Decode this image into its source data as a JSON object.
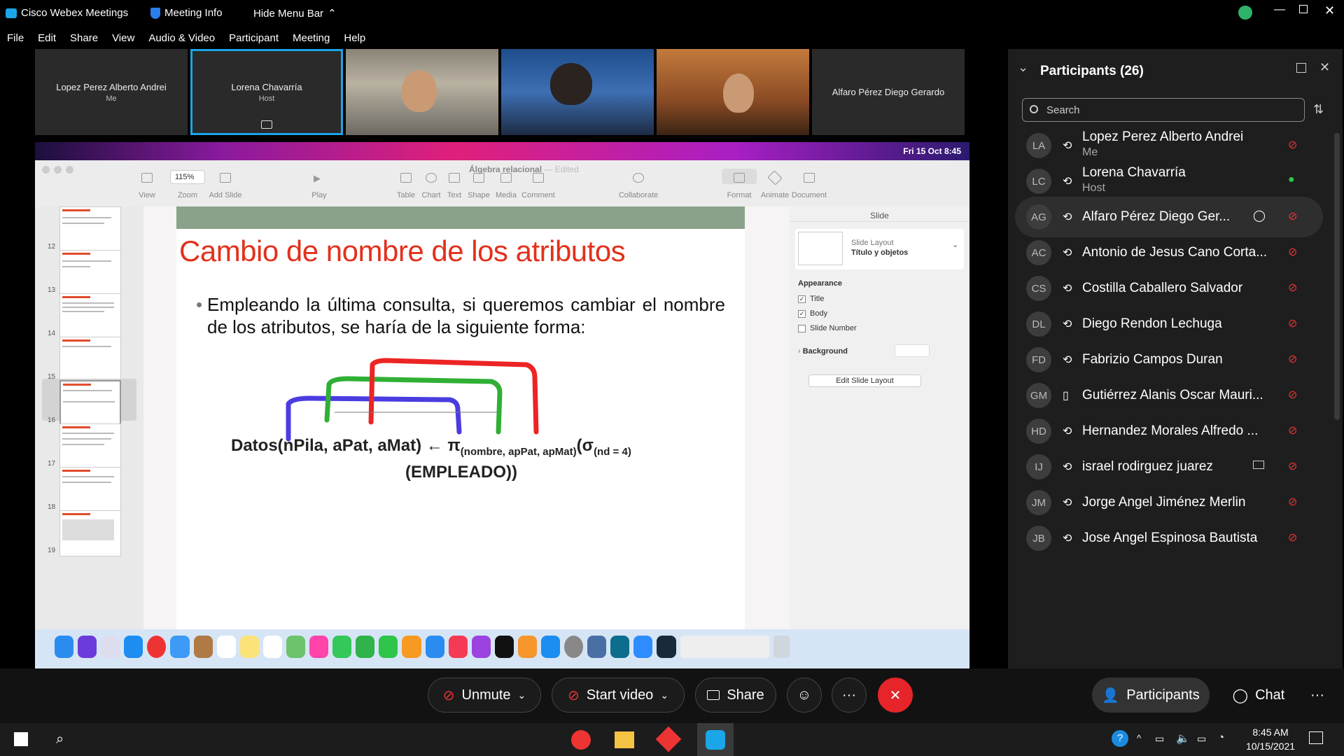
{
  "titlebar": {
    "app": "Cisco Webex Meetings",
    "meeting_info": "Meeting Info",
    "hide_menu": "Hide Menu Bar"
  },
  "menu": [
    "File",
    "Edit",
    "Share",
    "View",
    "Audio & Video",
    "Participant",
    "Meeting",
    "Help"
  ],
  "strip": [
    {
      "name": "Lopez Perez Alberto Andrei",
      "sub": "Me"
    },
    {
      "name": "Lorena Chavarría",
      "sub": "Host"
    },
    {
      "name": "Alfaro Pérez Diego Gerardo",
      "sub": ""
    }
  ],
  "share": {
    "mac_clock": "Fri 15 Oct  8:45",
    "doc_title": "Álgebra relacional",
    "doc_state": "— Edited",
    "toolbar": {
      "view": "View",
      "zoom_value": "115%",
      "zoom": "Zoom",
      "add_slide": "Add Slide",
      "play": "Play",
      "table": "Table",
      "chart": "Chart",
      "text": "Text",
      "shape": "Shape",
      "media": "Media",
      "comment": "Comment",
      "collaborate": "Collaborate",
      "format": "Format",
      "animate": "Animate",
      "document": "Document"
    },
    "slide_numbers": [
      "12",
      "13",
      "14",
      "15",
      "16",
      "17",
      "18",
      "19"
    ],
    "slide": {
      "title": "Cambio de nombre de los atributos",
      "bullet": "Empleando la última consulta, si queremos cambiar el nombre de los atributos, se haría de la siguiente forma:",
      "formula_main": "Datos(nPila, aPat, aMat) ← π",
      "formula_sub1": "(nombre, apPat, apMat)",
      "formula_sigma": "(σ",
      "formula_sub2": "(nd = 4)",
      "formula_line2": "(EMPLEADO))"
    },
    "inspector": {
      "tab": "Slide",
      "layout_label": "Slide Layout",
      "layout_value": "Título y objetos",
      "appearance": "Appearance",
      "title_cb": "Title",
      "body_cb": "Body",
      "slidenum_cb": "Slide Number",
      "background": "Background",
      "edit_layout": "Edit Slide Layout"
    }
  },
  "controls": {
    "unmute": "Unmute",
    "start_video": "Start video",
    "share": "Share",
    "participants": "Participants",
    "chat": "Chat"
  },
  "panel": {
    "title": "Participants (26)",
    "search_placeholder": "Search",
    "participants": [
      {
        "initials": "LA",
        "name": "Lopez Perez Alberto Andrei",
        "sub": "Me"
      },
      {
        "initials": "LC",
        "name": "Lorena Chavarría",
        "sub": "Host"
      },
      {
        "initials": "AG",
        "name": "Alfaro Pérez Diego Ger...",
        "sub": ""
      },
      {
        "initials": "AC",
        "name": "Antonio de Jesus Cano Corta...",
        "sub": ""
      },
      {
        "initials": "CS",
        "name": "Costilla Caballero Salvador",
        "sub": ""
      },
      {
        "initials": "DL",
        "name": "Diego Rendon Lechuga",
        "sub": ""
      },
      {
        "initials": "FD",
        "name": "Fabrizio Campos Duran",
        "sub": ""
      },
      {
        "initials": "GM",
        "name": "Gutiérrez Alanis Oscar Mauri...",
        "sub": ""
      },
      {
        "initials": "HD",
        "name": "Hernandez Morales Alfredo ...",
        "sub": ""
      },
      {
        "initials": "IJ",
        "name": "israel rodirguez juarez",
        "sub": ""
      },
      {
        "initials": "JM",
        "name": "Jorge Angel Jiménez Merlin",
        "sub": ""
      },
      {
        "initials": "JB",
        "name": "Jose Angel Espinosa Bautista",
        "sub": ""
      }
    ]
  },
  "taskbar": {
    "time": "8:45 AM",
    "date": "10/15/2021"
  },
  "colors": {
    "accent": "#1aa6e8",
    "end": "#e5252a",
    "title_red": "#e2311c"
  }
}
